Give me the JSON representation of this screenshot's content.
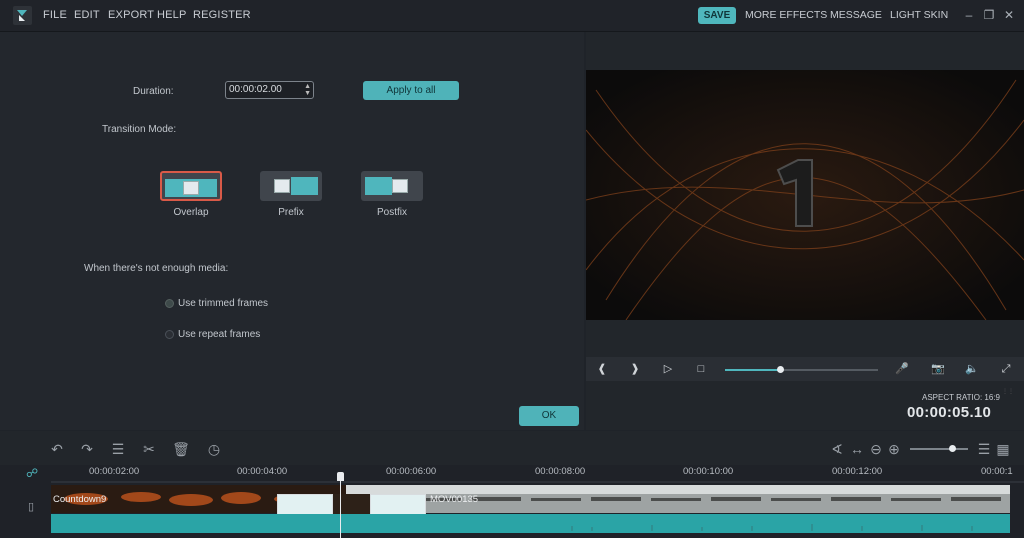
{
  "menu": {
    "file": "FILE",
    "edit": "EDIT",
    "export": "EXPORT",
    "help": "HELP",
    "register": "REGISTER"
  },
  "topright": {
    "save": "SAVE",
    "more_effects": "MORE EFFECTS",
    "message": "MESSAGE",
    "light_skin": "LIGHT SKIN"
  },
  "transition_settings": {
    "duration_label": "Duration:",
    "duration_value": "00:00:02.00",
    "apply_all": "Apply to all",
    "mode_label": "Transition Mode:",
    "modes": [
      {
        "label": "Overlap",
        "selected": true
      },
      {
        "label": "Prefix",
        "selected": false
      },
      {
        "label": "Postfix",
        "selected": false
      }
    ],
    "not_enough_label": "When there's not enough media:",
    "options": [
      {
        "label": "Use trimmed frames",
        "selected": true
      },
      {
        "label": "Use repeat frames",
        "selected": false
      }
    ],
    "ok": "OK"
  },
  "preview": {
    "aspect_ratio": "ASPECT RATIO: 16:9",
    "timecode": "00:00:05.10",
    "progress": 0.36
  },
  "timeline": {
    "ticks": [
      "00:00:02:00",
      "00:00:04:00",
      "00:00:06:00",
      "00:00:08:00",
      "00:00:10:00",
      "00:00:12:00",
      "00:00:1"
    ],
    "clips": [
      "Countdown9",
      "MOV00135"
    ]
  },
  "colors": {
    "accent": "#4fb6bd",
    "selection": "#d95a48",
    "background": "#23272d"
  }
}
